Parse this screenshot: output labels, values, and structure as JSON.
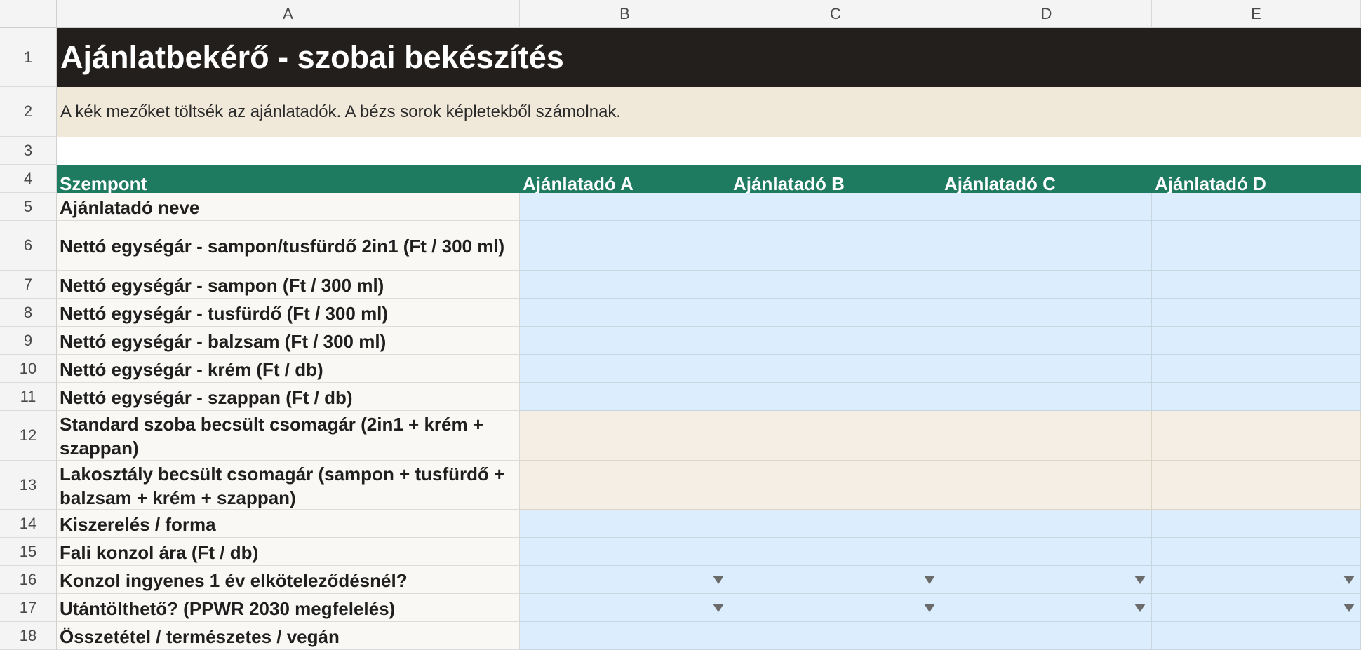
{
  "columns": [
    "A",
    "B",
    "C",
    "D",
    "E"
  ],
  "rows": [
    "1",
    "2",
    "3",
    "4",
    "5",
    "6",
    "7",
    "8",
    "9",
    "10",
    "11",
    "12",
    "13",
    "14",
    "15",
    "16",
    "17",
    "18"
  ],
  "title": "Ajánlatbekérő - szobai bekészítés",
  "note": "A kék mezőket töltsék az ajánlatadók. A bézs sorok képletekből számolnak.",
  "header": {
    "criterion": "Szempont",
    "bidders": [
      "Ajánlatadó A",
      "Ajánlatadó B",
      "Ajánlatadó C",
      "Ajánlatadó D"
    ]
  },
  "criteria": [
    {
      "label": "Ajánlatadó neve",
      "kind": "input"
    },
    {
      "label": "Nettó egységár - sampon/tusfürdő 2in1 (Ft / 300 ml)",
      "kind": "input"
    },
    {
      "label": "Nettó egységár - sampon (Ft / 300 ml)",
      "kind": "input"
    },
    {
      "label": "Nettó egységár - tusfürdő (Ft / 300 ml)",
      "kind": "input"
    },
    {
      "label": "Nettó egységár - balzsam (Ft / 300 ml)",
      "kind": "input"
    },
    {
      "label": "Nettó egységár - krém (Ft / db)",
      "kind": "input"
    },
    {
      "label": "Nettó egységár - szappan (Ft / db)",
      "kind": "input"
    },
    {
      "label": "Standard szoba becsült csomagár (2in1 + krém + szappan)",
      "kind": "calc"
    },
    {
      "label": "Lakosztály becsült csomagár (sampon + tusfürdő + balzsam + krém + szappan)",
      "kind": "calc"
    },
    {
      "label": "Kiszerelés / forma",
      "kind": "input"
    },
    {
      "label": "Fali konzol ára (Ft / db)",
      "kind": "input"
    },
    {
      "label": "Konzol ingyenes 1 év elköteleződésnél?",
      "kind": "dropdown"
    },
    {
      "label": "Utántölthető? (PPWR 2030 megfelelés)",
      "kind": "dropdown"
    },
    {
      "label": "Összetétel / természetes / vegán",
      "kind": "input"
    }
  ],
  "colors": {
    "title_bg": "#221f1c",
    "note_bg": "#f0e8d9",
    "header_bg": "#1e7b60",
    "input_bg": "#dceefd",
    "calc_bg": "#f4eee5",
    "label_bg": "#f9f8f4"
  },
  "icons": {
    "dropdown": "triangle-down-icon"
  }
}
